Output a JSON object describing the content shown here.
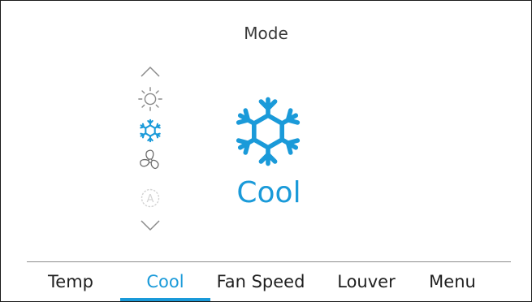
{
  "screen": {
    "title": "Mode"
  },
  "mode_list": {
    "items": [
      {
        "name": "heat",
        "icon": "sun-icon",
        "selected": false,
        "enabled": true
      },
      {
        "name": "cool",
        "icon": "snowflake-icon",
        "selected": true,
        "enabled": true
      },
      {
        "name": "fan",
        "icon": "fan-icon",
        "selected": false,
        "enabled": true
      },
      {
        "name": "auto",
        "icon": "auto-icon",
        "selected": false,
        "enabled": false
      }
    ]
  },
  "current_mode": {
    "icon": "snowflake-icon",
    "label": "Cool"
  },
  "nav": {
    "tabs": [
      {
        "label": "Temp",
        "active": false
      },
      {
        "label": "Cool",
        "active": true
      },
      {
        "label": "Fan Speed",
        "active": false
      },
      {
        "label": "Louver",
        "active": false
      },
      {
        "label": "Menu",
        "active": false
      }
    ]
  },
  "colors": {
    "accent": "#1a9ad9",
    "text": "#1f1f1f",
    "muted_icon": "#8a8a8a",
    "disabled_icon": "#d4d4d4"
  }
}
